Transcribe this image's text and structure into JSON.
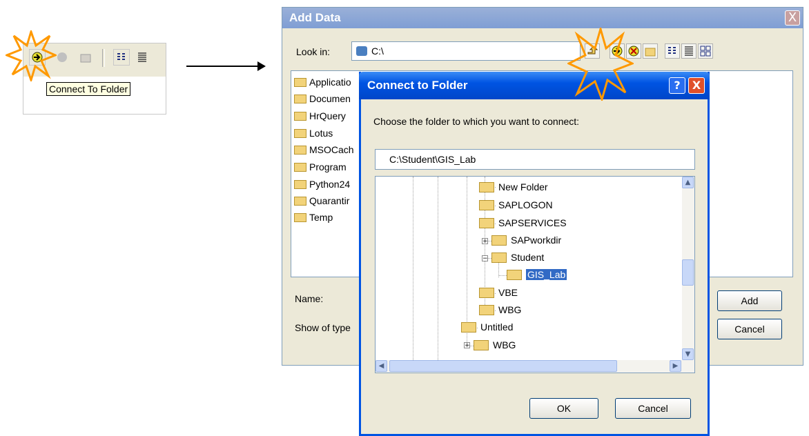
{
  "mini_toolbar": {
    "tooltip": "Connect To Folder",
    "icons": [
      "connect-folder-icon",
      "globe-icon",
      "new-folder-icon",
      "list-view-icon",
      "details-view-icon"
    ]
  },
  "add_data": {
    "title": "Add Data",
    "close": "X",
    "look_in_label": "Look in:",
    "look_in_value": "C:\\",
    "toolbar_icons": [
      "up-one-level-icon",
      "connect-folder-icon",
      "disconnect-folder-icon",
      "new-folder-icon",
      "list-view-icon",
      "details-view-icon",
      "thumbnails-view-icon"
    ],
    "files": [
      "Applicatio",
      "Documen",
      "HrQuery",
      "Lotus",
      "MSOCach",
      "Program",
      "Python24",
      "Quarantir",
      "Temp"
    ],
    "name_label": "Name:",
    "type_label": "Show of type",
    "add_button": "Add",
    "cancel_button": "Cancel"
  },
  "connect_dialog": {
    "title": "Connect to Folder",
    "help": "?",
    "close": "X",
    "prompt": "Choose the folder to which you want to connect:",
    "path": "C:\\Student\\GIS_Lab",
    "tree": [
      {
        "label": "New Folder"
      },
      {
        "label": "SAPLOGON"
      },
      {
        "label": "SAPSERVICES"
      },
      {
        "label": "SAPworkdir"
      },
      {
        "label": "Student"
      },
      {
        "label": "GIS_Lab",
        "selected": true
      },
      {
        "label": "VBE"
      },
      {
        "label": "WBG"
      },
      {
        "label": "Untitled"
      },
      {
        "label": "WBG"
      }
    ],
    "ok_button": "OK",
    "cancel_button": "Cancel"
  },
  "colors": {
    "xp_title_blue": "#0054e3",
    "selection": "#316ac5",
    "highlight_star": "#ff9900"
  }
}
